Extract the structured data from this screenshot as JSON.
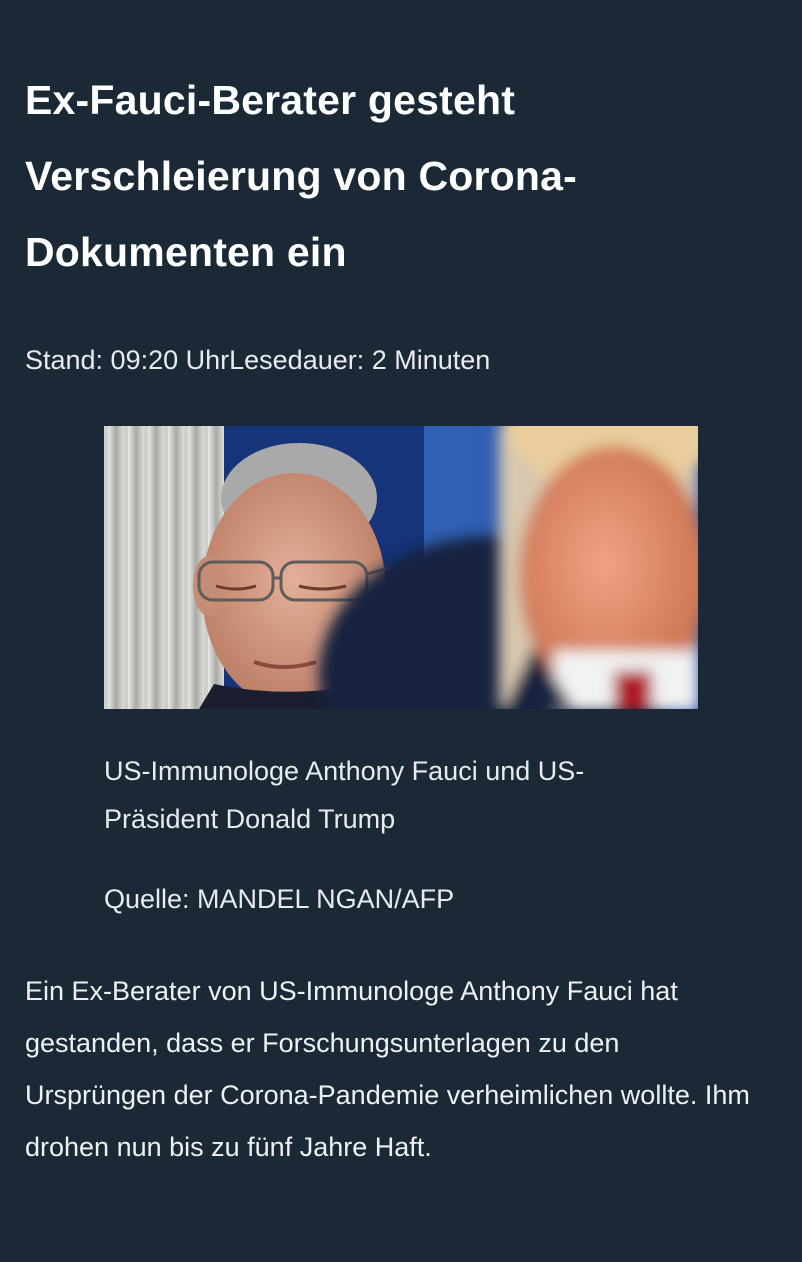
{
  "article": {
    "headline": "Ex-Fauci-Berater gesteht Verschleierung von Corona-Dokumenten ein",
    "meta": "Stand: 09:20 UhrLesedauer: 2 Minuten",
    "image": {
      "caption": "US-Immunologe Anthony Fauci und US-Präsident Donald Trump",
      "credit": "Quelle: MANDEL NGAN/AFP"
    },
    "lead": "Ein Ex-Berater von US-Immunologe Anthony Fauci hat gestanden, dass er Forschungsunterlagen zu den Ursprüngen der Corona-Pandemie verheimlichen wollte. Ihm drohen nun bis zu fünf Jahre Haft."
  },
  "colors": {
    "background": "#1b2836",
    "text": "#ffffff",
    "photo_blue": "#2c5fb8"
  }
}
